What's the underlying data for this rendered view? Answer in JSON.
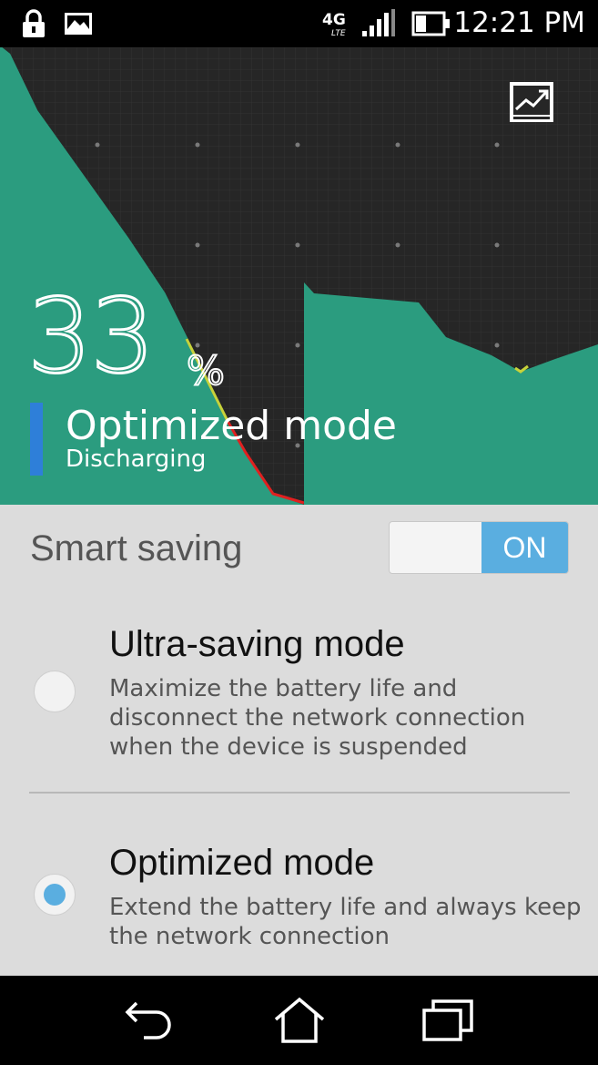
{
  "status_bar": {
    "time": "12:21 PM",
    "network_type": "4G LTE",
    "icons": [
      "lock-icon",
      "image-icon",
      "lte-icon",
      "signal-icon",
      "battery-icon"
    ]
  },
  "battery": {
    "percent": "33",
    "percent_sign": "%",
    "mode_title": "Optimized mode",
    "status": "Discharging",
    "graph_button_icon": "chart-icon",
    "colors": {
      "graph_fill": "#2b9c7f",
      "graph_bg": "#262626",
      "accent": "#2e7fd9"
    }
  },
  "smart_saving": {
    "label": "Smart saving",
    "toggle_state": "ON",
    "toggle_color": "#5aaee0"
  },
  "options": [
    {
      "title": "Ultra-saving mode",
      "description": "Maximize the battery life and disconnect the network connection when the device is suspended",
      "selected": false
    },
    {
      "title": "Optimized mode",
      "description": "Extend the battery life and always keep the network connection",
      "selected": true
    }
  ],
  "nav_bar": {
    "icons": [
      "back-icon",
      "home-icon",
      "recents-icon"
    ]
  }
}
